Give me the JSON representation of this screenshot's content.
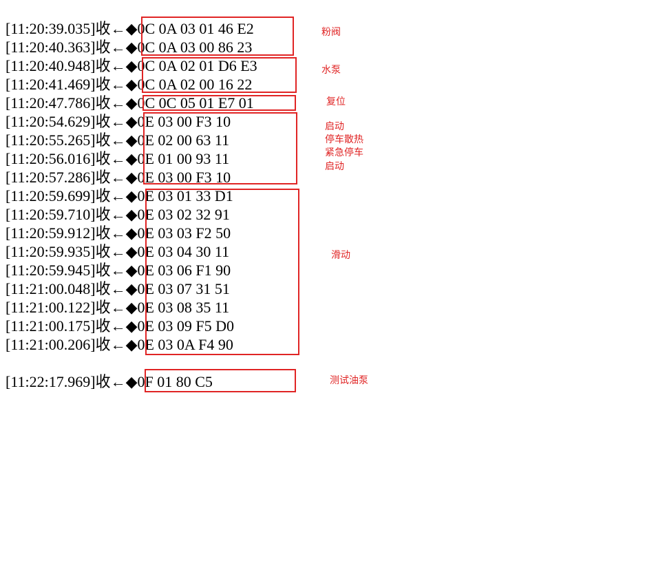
{
  "log_lines": [
    {
      "time": "[11:20:39.035]",
      "dir": "收←◆",
      "hex": "0C 0A 03 01 46 E2"
    },
    {
      "time": "[11:20:40.363]",
      "dir": "收←◆",
      "hex": "0C 0A 03 00 86 23"
    },
    {
      "time": "[11:20:40.948]",
      "dir": "收←◆",
      "hex": "0C 0A 02 01 D6 E3"
    },
    {
      "time": "[11:20:41.469]",
      "dir": "收←◆",
      "hex": "0C 0A 02 00 16 22"
    },
    {
      "time": "[11:20:47.786]",
      "dir": "收←◆",
      "hex": "0C 0C 05 01 E7 01"
    },
    {
      "time": "[11:20:54.629]",
      "dir": "收←◆",
      "hex": "0E 03 00 F3 10"
    },
    {
      "time": "[11:20:55.265]",
      "dir": "收←◆",
      "hex": "0E 02 00 63 11"
    },
    {
      "time": "[11:20:56.016]",
      "dir": "收←◆",
      "hex": "0E 01 00 93 11"
    },
    {
      "time": "[11:20:57.286]",
      "dir": "收←◆",
      "hex": "0E 03 00 F3 10"
    },
    {
      "time": "[11:20:59.699]",
      "dir": "收←◆",
      "hex": "0E 03 01 33 D1"
    },
    {
      "time": "[11:20:59.710]",
      "dir": "收←◆",
      "hex": "0E 03 02 32 91"
    },
    {
      "time": "[11:20:59.912]",
      "dir": "收←◆",
      "hex": "0E 03 03 F2 50"
    },
    {
      "time": "[11:20:59.935]",
      "dir": "收←◆",
      "hex": "0E 03 04 30 11"
    },
    {
      "time": "[11:20:59.945]",
      "dir": "收←◆",
      "hex": "0E 03 06 F1 90"
    },
    {
      "time": "[11:21:00.048]",
      "dir": "收←◆",
      "hex": "0E 03 07 31 51"
    },
    {
      "time": "[11:21:00.122]",
      "dir": "收←◆",
      "hex": "0E 03 08 35 11"
    },
    {
      "time": "[11:21:00.175]",
      "dir": "收←◆",
      "hex": "0E 03 09 F5 D0"
    },
    {
      "time": "[11:21:00.206]",
      "dir": "收←◆",
      "hex": "0E 03 0A F4 90"
    },
    {
      "time": "[11:22:17.969]",
      "dir": "收←◆",
      "hex": "0F 01 80 C5"
    }
  ],
  "annotations": {
    "powder_valve": "粉阀",
    "water_pump": "水泵",
    "reset": "复位",
    "start_1": "启动",
    "stop_cooling": "停车散热",
    "emergency_stop": "紧急停车",
    "start_2": "启动",
    "slide": "滑动",
    "test_oil_pump": "测试油泵"
  },
  "colors": {
    "annotation": "#e02424",
    "log_text": "#000000"
  }
}
